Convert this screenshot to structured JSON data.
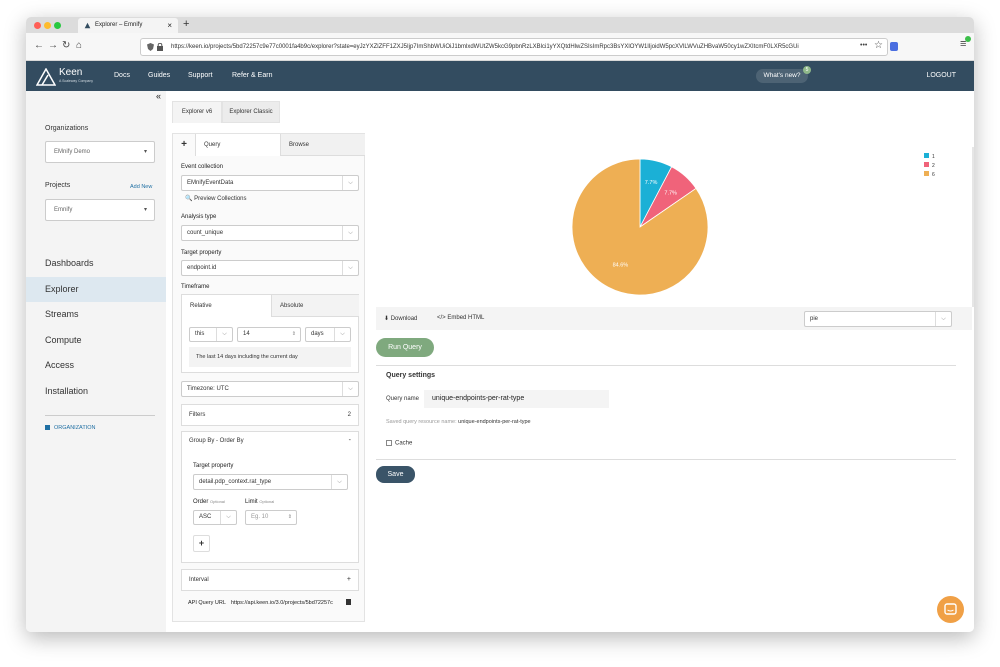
{
  "browser": {
    "tab_title": "Explorer – Emnify",
    "new_tab": "+",
    "url_domain": "keen.io",
    "url": "https://keen.io/projects/5bd72257c9e77c0001fa4b9c/explorer?state=eyJzYXZlZFF1ZXJ5Ijp7ImShbWUiOiJ1bmlxdWUtZW5kcG9pbnRzLXBlci1yYXQtdHlwZSIsImRpc3BsYXlOYW1lIjoidW5pcXVlLWVuZHBvaW50cy1wZXItcmF0LXR5cGUi",
    "more": "•••"
  },
  "topnav": {
    "logo_name": "Keen",
    "logo_tagline": "A Scaleway Company",
    "items": [
      "Docs",
      "Guides",
      "Support",
      "Refer & Earn"
    ],
    "whats_new": "What's new?",
    "whats_new_count": "5",
    "logout": "LOGOUT"
  },
  "sidebar": {
    "collapse": "«",
    "organizations_label": "Organizations",
    "organization": "EMnify Demo",
    "projects_label": "Projects",
    "add_new": "Add New",
    "project": "Emnify",
    "nav": [
      "Dashboards",
      "Explorer",
      "Streams",
      "Compute",
      "Access",
      "Installation"
    ],
    "active": "Explorer",
    "org_link": "ORGANIZATION"
  },
  "explorer": {
    "tabs": [
      "Explorer v6",
      "Explorer Classic"
    ],
    "sub_tabs": {
      "add": "+",
      "query": "Query",
      "browse": "Browse"
    },
    "event_collection_label": "Event collection",
    "event_collection": "EMnifyEventData",
    "preview_collections": "Preview Collections",
    "analysis_type_label": "Analysis type",
    "analysis_type": "count_unique",
    "target_property_label": "Target property",
    "target_property": "endpoint.id",
    "timeframe_label": "Timeframe",
    "timeframe_tabs": [
      "Relative",
      "Absolute"
    ],
    "tf_relative": "this",
    "tf_amount": "14",
    "tf_units": "days",
    "tf_description": "The last 14 days including the current day",
    "timezone": "Timezone: UTC",
    "filters_label": "Filters",
    "filters_count": "2",
    "group_by_label": "Group By - Order By",
    "group_by_toggle": "-",
    "gb_target_label": "Target property",
    "gb_target": "detail.pdp_context.rat_type",
    "order_label": "Order",
    "order_optional": "Optional",
    "order_value": "ASC",
    "limit_label": "Limit",
    "limit_optional": "Optional",
    "limit_placeholder": "Eg. 10",
    "add_group": "+",
    "interval_label": "Interval",
    "interval_toggle": "+",
    "api_url_label": "API Query URL",
    "api_url": "https://api.keen.io/3.0/projects/5bd72257c"
  },
  "results": {
    "download": "Download",
    "embed_html": "Embed HTML",
    "chart_type": "pie",
    "run_query": "Run Query",
    "settings_title": "Query settings",
    "query_name_label": "Query name",
    "query_name": "unique-endpoints-per-rat-type",
    "saved_resource_label": "Saved query resource name:",
    "saved_resource": "unique-endpoints-per-rat-type",
    "cache_label": "Cache",
    "save": "Save"
  },
  "chart_data": {
    "type": "pie",
    "categories": [
      "1",
      "2",
      "6"
    ],
    "values": [
      7.7,
      7.7,
      84.6
    ],
    "labels": [
      "7.7%",
      "7.7%",
      "84.6%"
    ],
    "colors": [
      "#1bb0d6",
      "#f0637a",
      "#eeaf54"
    ],
    "legend_position": "top-right"
  },
  "colors": {
    "accent": "#334c60",
    "run": "#7fa97e",
    "chat": "#f0a046"
  }
}
